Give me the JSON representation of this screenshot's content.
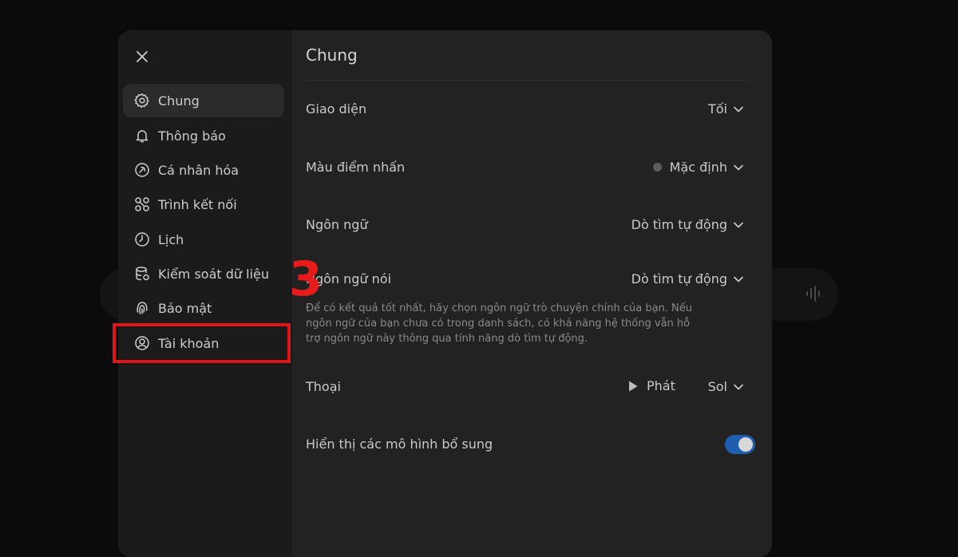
{
  "colors": {
    "accent": "#1d5fae",
    "annotation": "#e0141b"
  },
  "sidebar": {
    "items": [
      {
        "label": "Chung",
        "icon": "gear-icon",
        "active": true
      },
      {
        "label": "Thông báo",
        "icon": "bell-icon"
      },
      {
        "label": "Cá nhân hóa",
        "icon": "personalize-icon"
      },
      {
        "label": "Trình kết nối",
        "icon": "connectors-icon"
      },
      {
        "label": "Lịch",
        "icon": "clock-icon"
      },
      {
        "label": "Kiểm soát dữ liệu",
        "icon": "database-icon"
      },
      {
        "label": "Bảo mật",
        "icon": "fingerprint-icon"
      },
      {
        "label": "Tài khoản",
        "icon": "account-icon"
      }
    ]
  },
  "main": {
    "title": "Chung",
    "settings": {
      "theme": {
        "label": "Giao diện",
        "value": "Tối"
      },
      "accent": {
        "label": "Màu điểm nhấn",
        "value": "Mặc định"
      },
      "language": {
        "label": "Ngôn ngữ",
        "value": "Dò tìm tự động"
      },
      "spoken_language": {
        "label": "Ngôn ngữ nói",
        "value": "Dò tìm tự động",
        "hint": "Để có kết quả tốt nhất, hãy chọn ngôn ngữ trò chuyện chính của bạn. Nếu ngôn ngữ của bạn chưa có trong danh sách, có khả năng hệ thống vẫn hỗ trợ ngôn ngữ này thông qua tính năng dò tìm tự động."
      },
      "voice": {
        "label": "Thoại",
        "play_label": "Phát",
        "value": "Sol"
      },
      "extra_models": {
        "label": "Hiển thị các mô hình bổ sung",
        "enabled": true
      }
    }
  },
  "annotation": {
    "step_number": "3"
  }
}
